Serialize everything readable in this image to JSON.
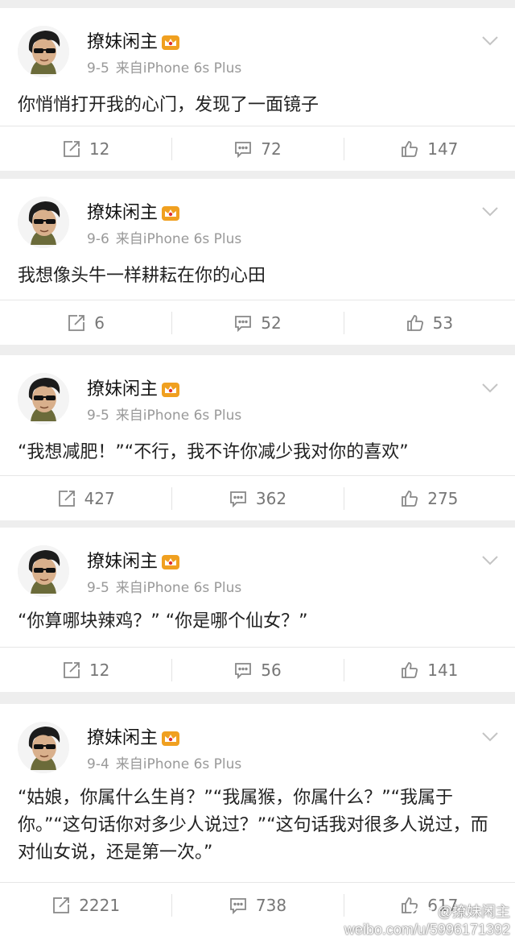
{
  "posts": [
    {
      "username": "撩妹闲主",
      "date": "9-5",
      "source": "来自iPhone 6s Plus",
      "text": "你悄悄打开我的心门，发现了一面镜子",
      "reposts": "12",
      "comments": "72",
      "likes": "147"
    },
    {
      "username": "撩妹闲主",
      "date": "9-6",
      "source": "来自iPhone 6s Plus",
      "text": "我想像头牛一样耕耘在你的心田",
      "reposts": "6",
      "comments": "52",
      "likes": "53"
    },
    {
      "username": "撩妹闲主",
      "date": "9-5",
      "source": "来自iPhone 6s Plus",
      "text": "“我想减肥！”“不行，我不许你减少我对你的喜欢”",
      "reposts": "427",
      "comments": "362",
      "likes": "275"
    },
    {
      "username": "撩妹闲主",
      "date": "9-5",
      "source": "来自iPhone 6s Plus",
      "text": "“你算哪块辣鸡？” “你是哪个仙女？”",
      "reposts": "12",
      "comments": "56",
      "likes": "141"
    },
    {
      "username": "撩妹闲主",
      "date": "9-4",
      "source": "来自iPhone 6s Plus",
      "text": "“姑娘，你属什么生肖？”“我属猴，你属什么？”“我属于你。”“这句话你对多少人说过？”“这句话我对很多人说过，而对仙女说，还是第一次。”",
      "reposts": "2221",
      "comments": "738",
      "likes": "617"
    }
  ],
  "icons": {
    "repost": "repost-icon",
    "comment": "comment-icon",
    "like": "thumbs-up-icon",
    "more": "chevron-down-icon",
    "badge": "crown-badge-icon"
  },
  "colors": {
    "background": "#eeeeee",
    "card": "#ffffff",
    "meta_text": "#999999",
    "badge": "#f0a020"
  },
  "watermark": {
    "handle": "@撩妹闲主",
    "url": "weibo.com/u/5996171392"
  }
}
